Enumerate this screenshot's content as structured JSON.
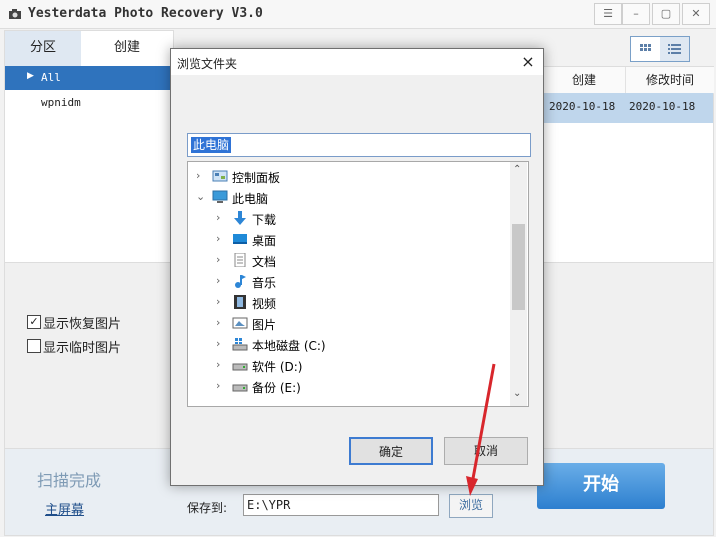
{
  "app": {
    "title": "Yesterdata Photo Recovery V3.0"
  },
  "left_panel": {
    "tabs": [
      "分区",
      "创建"
    ],
    "items": [
      "All",
      "wpnidm"
    ]
  },
  "right_panel": {
    "columns": [
      "创建",
      "修改时间"
    ],
    "row": [
      "2020-10-18",
      "2020-10-18"
    ]
  },
  "options": {
    "show_recovered": {
      "label": "显示恢复图片",
      "checked": true
    },
    "show_temp": {
      "label": "显示临时图片",
      "checked": false
    }
  },
  "bottom": {
    "status": "扫描完成",
    "home_link": "主屏幕",
    "save_label": "保存到:",
    "save_path": "E:\\YPR",
    "browse_label": "浏览",
    "start_label": "开始"
  },
  "dialog": {
    "title": "浏览文件夹",
    "close_glyph": "×",
    "selected_folder": "此电脑",
    "tree": [
      {
        "label": "控制面板",
        "icon": "control-panel-icon",
        "indent": 0,
        "expanded": false
      },
      {
        "label": "此电脑",
        "icon": "computer-icon",
        "indent": 0,
        "expanded": true
      },
      {
        "label": "下载",
        "icon": "download-icon",
        "indent": 1,
        "expanded": false
      },
      {
        "label": "桌面",
        "icon": "desktop-icon",
        "indent": 1,
        "expanded": false
      },
      {
        "label": "文档",
        "icon": "document-icon",
        "indent": 1,
        "expanded": false
      },
      {
        "label": "音乐",
        "icon": "music-icon",
        "indent": 1,
        "expanded": false
      },
      {
        "label": "视频",
        "icon": "video-icon",
        "indent": 1,
        "expanded": false
      },
      {
        "label": "图片",
        "icon": "picture-icon",
        "indent": 1,
        "expanded": false
      },
      {
        "label": "本地磁盘 (C:)",
        "icon": "windows-drive-icon",
        "indent": 1,
        "expanded": false
      },
      {
        "label": "软件 (D:)",
        "icon": "drive-icon",
        "indent": 1,
        "expanded": false
      },
      {
        "label": "备份 (E:)",
        "icon": "drive-icon",
        "indent": 1,
        "expanded": false
      }
    ],
    "ok_label": "确定",
    "cancel_label": "取消"
  },
  "colors": {
    "selection_blue": "#2f73bd",
    "arrow_red": "#d8262c",
    "start_button": "#2d7fcf"
  }
}
